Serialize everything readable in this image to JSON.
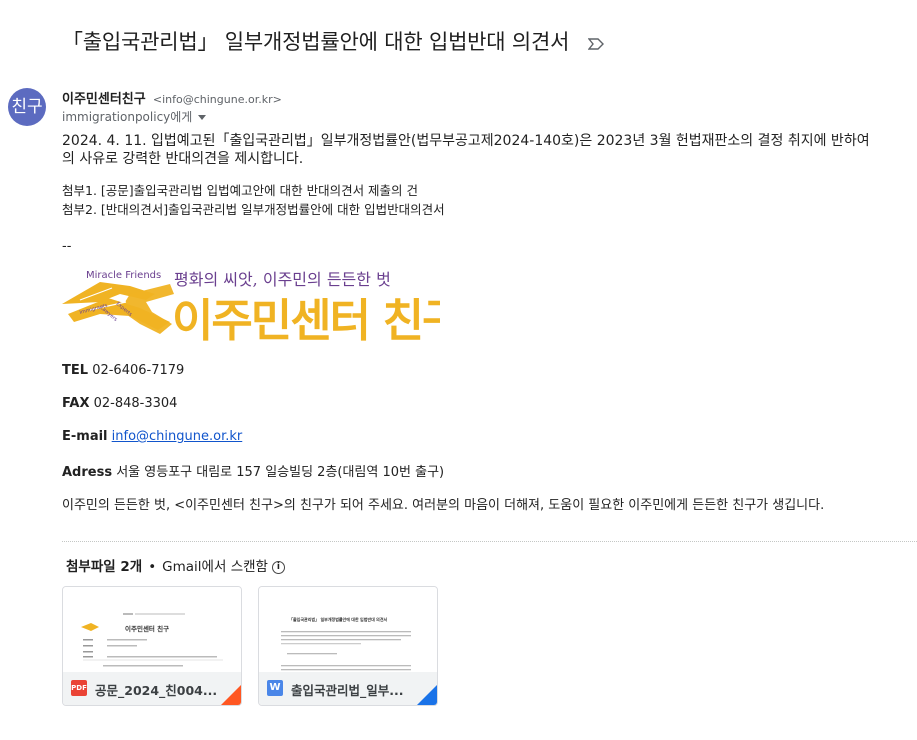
{
  "email": {
    "subject": "「출입국관리법」 일부개정법률안에 대한 입법반대 의견서",
    "avatar_text": "친구",
    "sender_name": "이주민센터친구",
    "sender_email": "<info@chingune.or.kr>",
    "to": "immigrationpolicy에게",
    "body_line1": "2024. 4. 11. 입법예고된「출입국관리법」일부개정법률안(법무부공고제2024-140호)은 2023년 3월 헌법재판소의 결정 취지에 반하여",
    "body_line2": "의 사유로 강력한 반대의견을 제시합니다.",
    "attach_line1": "첨부1. [공문]출입국관리법 입법예고안에 대한 반대의견서 제출의 건",
    "attach_line2": "첨부2. [반대의견서]출입국관리법 일부개정법률안에 대한 입법반대의견서",
    "sig_dashes": "--",
    "logo": {
      "tagline_en": "Miracle Friends",
      "slogan": "평화의 씨앗, 이주민의 든든한 벗",
      "org_name": "이주민센터 친구",
      "handshake_text_1": "Immigrants",
      "handshake_text_2": "Lawyers",
      "handshake_text_3": "Experts"
    },
    "tel_label": "TEL",
    "tel_value": "02-6406-7179",
    "fax_label": "FAX",
    "fax_value": "02-848-3304",
    "email_label": "E-mail",
    "email_value": "info@chingune.or.kr",
    "address_label": "Adress",
    "address_value": "서울 영등포구 대림로 157 일승빌딩 2층(대림역 10번 출구)",
    "closing": "이주민의 든든한 벗, <이주민센터 친구>의 친구가 되어 주세요. 여러분의 마음이 더해져, 도움이 필요한 이주민에게 든든한 친구가 생깁니다."
  },
  "attachments": {
    "header_count": "첨부파일 2개",
    "header_dot": "•",
    "header_scan": "Gmail에서 스캔함",
    "info_icon": "i",
    "files": [
      {
        "name": "공문_2024_친004...",
        "icon_label": "PDF",
        "icon_color": "#ea4335",
        "corner_color": "#ff5722",
        "preview_title": "이주민센터 친구"
      },
      {
        "name": "출입국관리법_일부...",
        "icon_label": "W",
        "icon_color": "#4a86e8",
        "corner_color": "#1a73e8",
        "preview_title": "「출입국관리법」 일부개정법률안에 대한 입법반대 의견서"
      }
    ]
  },
  "colors": {
    "avatar": "#5c6bc0",
    "logo_yellow": "#f0b323",
    "logo_purple": "#6a3f8f",
    "link": "#1155cc"
  }
}
